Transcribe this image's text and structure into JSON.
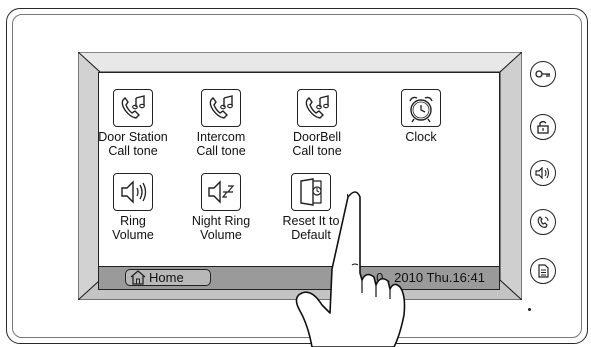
{
  "apps": [
    {
      "line1": "Door Station",
      "line2": "Call tone",
      "icon": "phone-note-icon"
    },
    {
      "line1": "Intercom",
      "line2": "Call tone",
      "icon": "phone-note-icon"
    },
    {
      "line1": "DoorBell",
      "line2": "Call tone",
      "icon": "phone-note-icon"
    },
    {
      "line1": "Clock",
      "line2": "",
      "icon": "alarm-clock-icon"
    },
    {
      "line1": "Ring",
      "line2": "Volume",
      "icon": "speaker-volume-icon"
    },
    {
      "line1": "Night Ring",
      "line2": "Volume",
      "icon": "speaker-sleep-icon"
    },
    {
      "line1": "Reset It to",
      "line2": "Default",
      "icon": "reset-door-icon"
    }
  ],
  "statusbar": {
    "home_label": "Home",
    "datetime": "0 . 2010  Thu.16:41"
  },
  "side_buttons": [
    "key-icon",
    "unlock-icon",
    "speaker-icon",
    "handset-icon",
    "document-icon"
  ]
}
